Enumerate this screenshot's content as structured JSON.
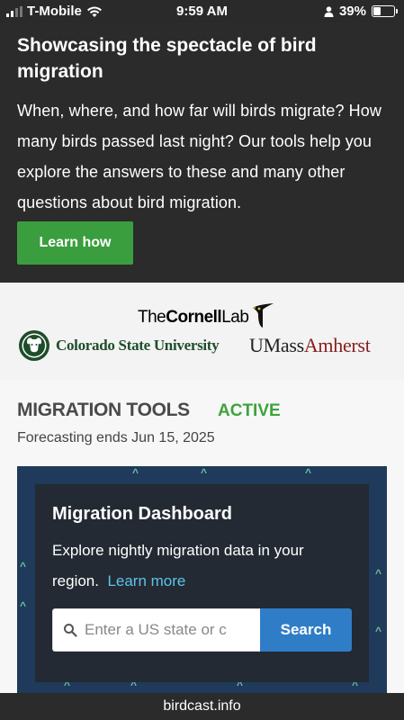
{
  "status_bar": {
    "carrier": "T-Mobile",
    "time": "9:59 AM",
    "battery": "39%",
    "battery_level": 0.39,
    "icons": [
      "signal-icon",
      "wifi-icon",
      "person-icon",
      "battery-icon"
    ]
  },
  "hero": {
    "title": "Showcasing the spectacle of bird migration",
    "text": "When, where, and how far will birds migrate? How many birds passed last night? Our tools help you explore the answers to these and many other questions about bird migration.",
    "button_label": "Learn how"
  },
  "logos": {
    "cornell_the": "The",
    "cornell_name": "Cornell",
    "cornell_lab": "Lab",
    "csu": "Colorado State University",
    "umass_a": "UMass",
    "umass_b": "Amherst"
  },
  "tools": {
    "heading": "MIGRATION TOOLS",
    "status": "ACTIVE",
    "forecast": "Forecasting ends Jun 15, 2025"
  },
  "dashboard": {
    "title": "Migration Dashboard",
    "text": "Explore nightly migration data in your region.",
    "link": "Learn more",
    "search_placeholder": "Enter a US state or c",
    "search_button": "Search"
  },
  "url": "birdcast.info",
  "colors": {
    "accent_green": "#3a9e3f",
    "active_green": "#3da33d",
    "link_blue": "#5ec3e9",
    "search_blue": "#2f7dc6",
    "panel_navy": "#1f3a5a"
  }
}
